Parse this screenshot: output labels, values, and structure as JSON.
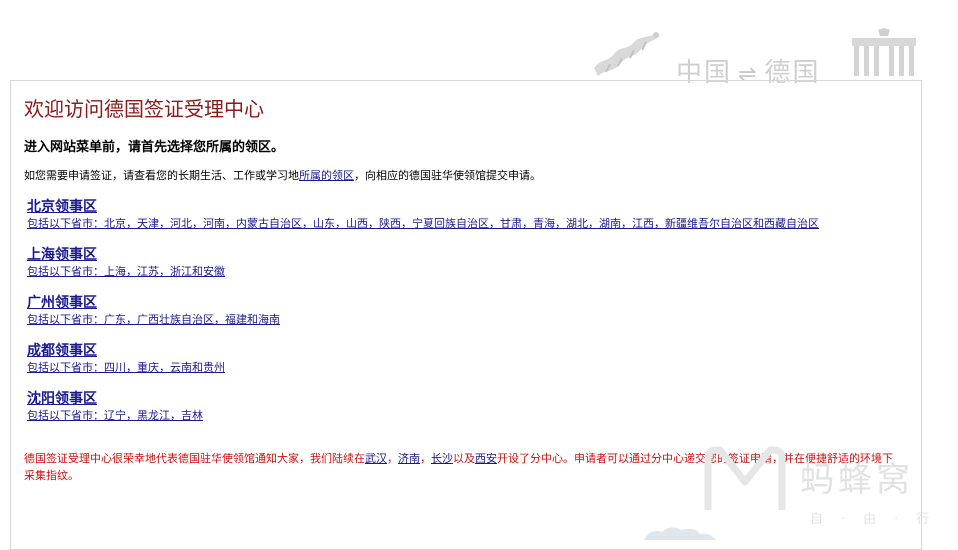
{
  "banner": {
    "left_text": "中国",
    "separator": "⇌",
    "right_text": "德国"
  },
  "page": {
    "title": "欢迎访问德国签证受理中心",
    "subtitle": "进入网站菜单前，请首先选择您所属的领区。",
    "intro_before": "如您需要申请签证，请查看您的长期生活、工作或学习地",
    "intro_link": "所属的领区",
    "intro_after": "，向相应的德国驻华使领馆提交申请。"
  },
  "consulates": [
    {
      "name": "北京领事区",
      "provinces": "包括以下省市：北京，天津，河北，河南，内蒙古自治区，山东，山西，陕西，宁夏回族自治区，甘肃，青海，湖北，湖南，江西，新疆维吾尔自治区和西藏自治区"
    },
    {
      "name": "上海领事区",
      "provinces": "包括以下省市：上海，江苏，浙江和安徽"
    },
    {
      "name": "广州领事区",
      "provinces": "包括以下省市：广东，广西壮族自治区，福建和海南"
    },
    {
      "name": "成都领事区",
      "provinces": "包括以下省市：四川，重庆，云南和贵州"
    },
    {
      "name": "沈阳领事区",
      "provinces": "包括以下省市：辽宁，黑龙江，吉林"
    }
  ],
  "notice": {
    "p1": "德国签证受理中心很荣幸地代表德国驻华使领馆通知大家，我们陆续在",
    "city1": "武汉",
    "sep1": "，",
    "city2": "济南",
    "sep2": "，",
    "city3": "长沙",
    "sep3": "以及",
    "city4": "西安",
    "p2": "开设了分中心。申请者可以通过分中心递交您的签证申请，并在便捷舒适的环境下采集指纹。"
  },
  "watermark": {
    "text": "蚂蜂窝",
    "sub": "自·由·行"
  },
  "colors": {
    "title": "#8b1a1a",
    "link": "#1a1a8c",
    "notice": "#cc1111",
    "border": "#d6d6d6"
  }
}
